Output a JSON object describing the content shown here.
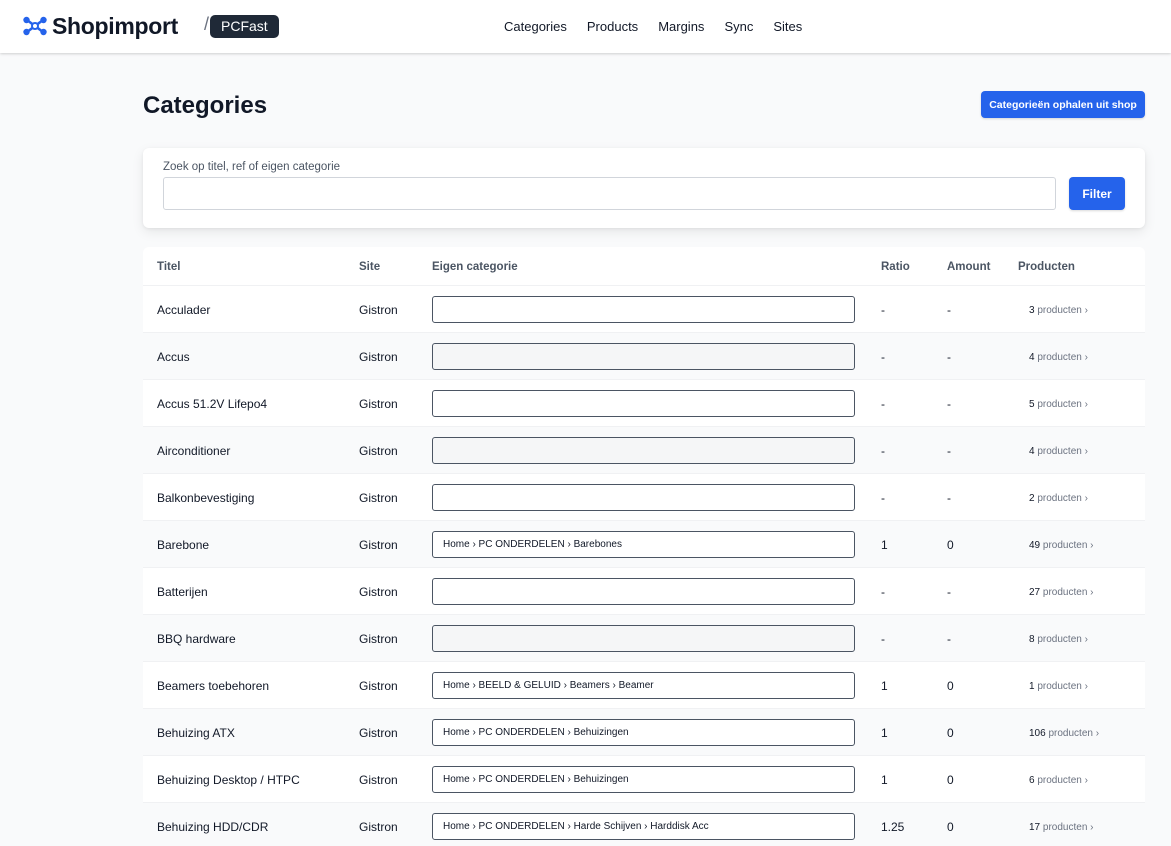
{
  "header": {
    "brand": "Shopimport",
    "site_badge": "PCFast",
    "nav": [
      "Categories",
      "Products",
      "Margins",
      "Sync",
      "Sites"
    ]
  },
  "page": {
    "title": "Categories",
    "fetch_button": "Categorieën ophalen uit shop"
  },
  "filter": {
    "label": "Zoek op titel, ref of eigen categorie",
    "value": "",
    "button": "Filter"
  },
  "table": {
    "columns": {
      "title": "Titel",
      "site": "Site",
      "category": "Eigen categorie",
      "ratio": "Ratio",
      "amount": "Amount",
      "products": "Producten"
    },
    "products_suffix": "producten ›",
    "rows": [
      {
        "title": "Acculader",
        "site": "Gistron",
        "category": "",
        "ratio": "-",
        "amount": "-",
        "count": "3"
      },
      {
        "title": "Accus",
        "site": "Gistron",
        "category": "",
        "ratio": "-",
        "amount": "-",
        "count": "4"
      },
      {
        "title": "Accus 51.2V Lifepo4",
        "site": "Gistron",
        "category": "",
        "ratio": "-",
        "amount": "-",
        "count": "5"
      },
      {
        "title": "Airconditioner",
        "site": "Gistron",
        "category": "",
        "ratio": "-",
        "amount": "-",
        "count": "4"
      },
      {
        "title": "Balkonbevestiging",
        "site": "Gistron",
        "category": "",
        "ratio": "-",
        "amount": "-",
        "count": "2"
      },
      {
        "title": "Barebone",
        "site": "Gistron",
        "category": "Home › PC ONDERDELEN › Barebones",
        "ratio": "1",
        "amount": "0",
        "count": "49"
      },
      {
        "title": "Batterijen",
        "site": "Gistron",
        "category": "",
        "ratio": "-",
        "amount": "-",
        "count": "27"
      },
      {
        "title": "BBQ hardware",
        "site": "Gistron",
        "category": "",
        "ratio": "-",
        "amount": "-",
        "count": "8"
      },
      {
        "title": "Beamers toebehoren",
        "site": "Gistron",
        "category": "Home › BEELD & GELUID › Beamers › Beamer",
        "ratio": "1",
        "amount": "0",
        "count": "1"
      },
      {
        "title": "Behuizing ATX",
        "site": "Gistron",
        "category": "Home › PC ONDERDELEN › Behuizingen",
        "ratio": "1",
        "amount": "0",
        "count": "106"
      },
      {
        "title": "Behuizing Desktop / HTPC",
        "site": "Gistron",
        "category": "Home › PC ONDERDELEN › Behuizingen",
        "ratio": "1",
        "amount": "0",
        "count": "6"
      },
      {
        "title": "Behuizing HDD/CDR",
        "site": "Gistron",
        "category": "Home › PC ONDERDELEN › Harde Schijven › Harddisk Acc",
        "ratio": "1.25",
        "amount": "0",
        "count": "17"
      }
    ]
  }
}
